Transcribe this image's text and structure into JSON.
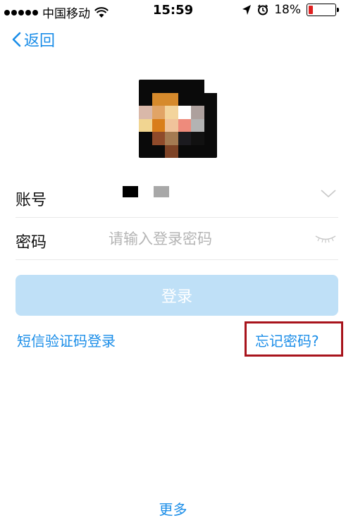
{
  "status_bar": {
    "carrier": "中国移动",
    "time": "15:59",
    "battery_percent": "18%",
    "battery_level": 0.18,
    "icons": [
      "signal-dots-icon",
      "wifi-icon",
      "location-arrow-icon",
      "alarm-icon",
      "battery-icon"
    ]
  },
  "nav": {
    "back_label": "返回"
  },
  "avatar": {
    "pixels": [
      "#0a0a0a",
      "#0a0a0a",
      "#0a0a0a",
      "#0a0a0a",
      "#0a0a0a",
      "#ffffff",
      "#0a0a0a",
      "#d68a2c",
      "#d68a2c",
      "#0a0a0a",
      "#0a0a0a",
      "#0a0a0a",
      "#d9b8a9",
      "#e1a466",
      "#f3d49c",
      "#ffffff",
      "#ada09d",
      "#0a0a0a",
      "#f1d591",
      "#d97e1a",
      "#f0c39b",
      "#ee8b7c",
      "#b3b3b3",
      "#0a0a0a",
      "#0a0a0a",
      "#8f4a2a",
      "#a47a52",
      "#1b1a1f",
      "#111111",
      "#0a0a0a",
      "#0a0a0a",
      "#0a0a0a",
      "#7e4326",
      "#0a0a0a",
      "#0a0a0a",
      "#0a0a0a"
    ]
  },
  "form": {
    "account_label": "账号",
    "account_value_blocks": [
      "#000000",
      "#a8a8a8"
    ],
    "password_label": "密码",
    "password_placeholder": "请输入登录密码"
  },
  "actions": {
    "login_label": "登录",
    "sms_login_label": "短信验证码登录",
    "forgot_password_label": "忘记密码?",
    "more_label": "更多"
  },
  "colors": {
    "accent": "#1a8de8",
    "login_button_disabled": "#bfe0f7",
    "highlight_box": "#a8141c"
  }
}
